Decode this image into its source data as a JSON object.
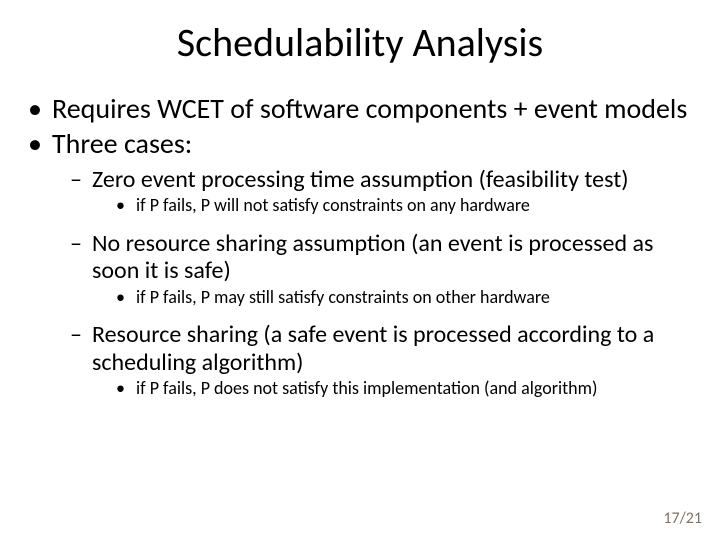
{
  "title": "Schedulability Analysis",
  "b1": "Requires WCET of software components + event models",
  "b2": "Three cases:",
  "c1": "Zero event processing time assumption (feasibility test)",
  "c1a": "if P fails, P will not satisfy constraints on any hardware",
  "c2": "No resource sharing assumption (an event is processed as soon it is safe)",
  "c2a": "if P fails, P may still satisfy constraints on other hardware",
  "c3": "Resource sharing (a safe event is processed according to a scheduling algorithm)",
  "c3a": "if P fails, P does not satisfy this implementation (and algorithm)",
  "page": "17/21"
}
